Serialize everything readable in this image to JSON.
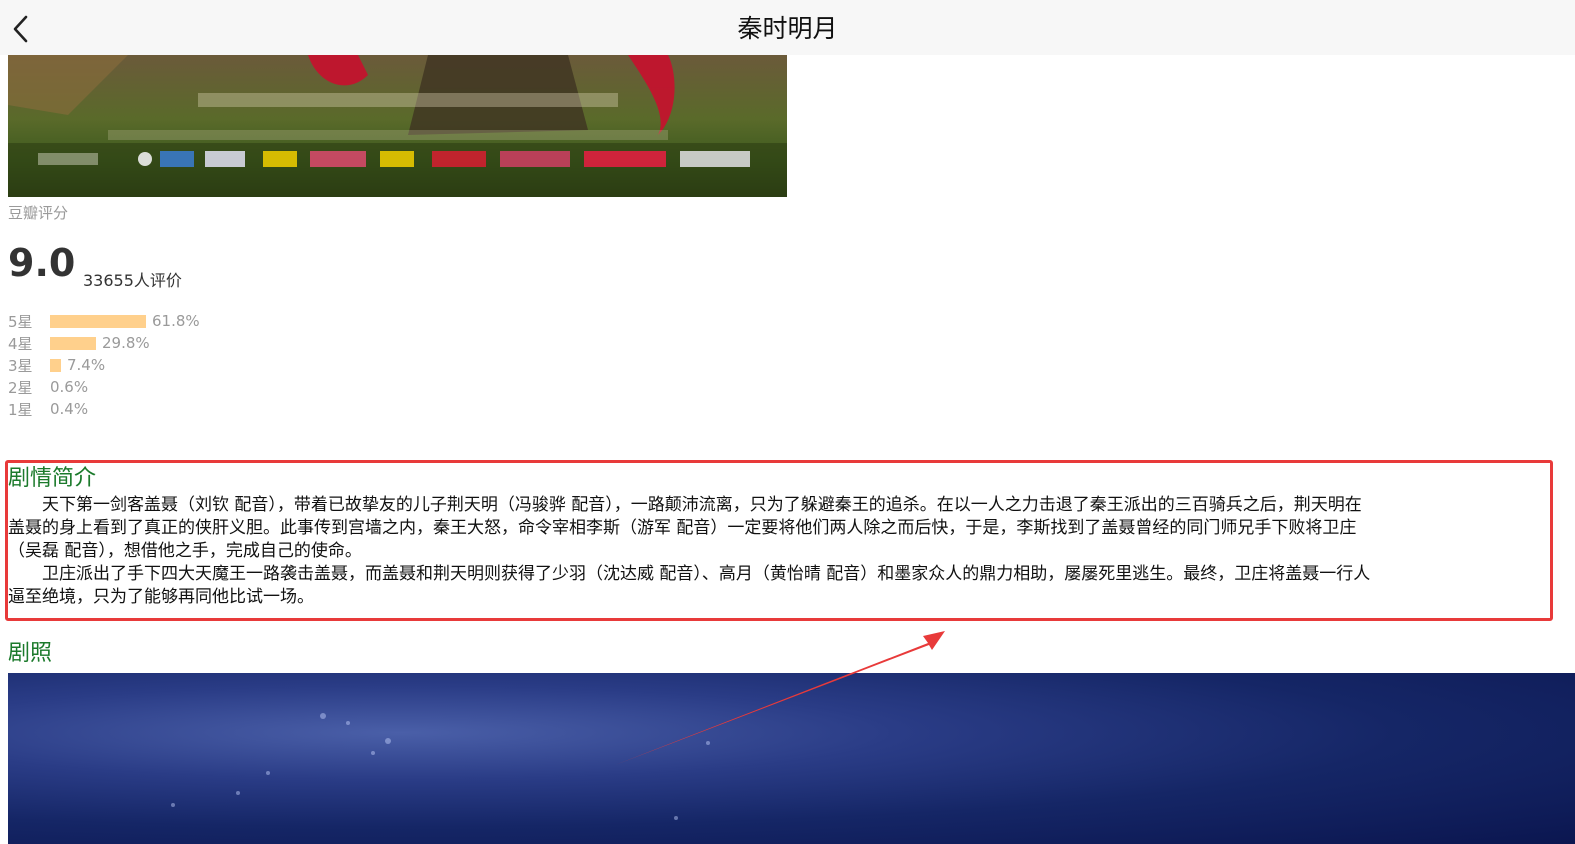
{
  "header": {
    "title": "秦时明月"
  },
  "rating": {
    "source_label": "豆瓣评分",
    "score": "9.0",
    "count_text": "33655人评价",
    "bar_color": "#ffd08c",
    "distribution": [
      {
        "label": "5星",
        "percent_text": "61.8%",
        "percent": 61.8
      },
      {
        "label": "4星",
        "percent_text": "29.8%",
        "percent": 29.8
      },
      {
        "label": "3星",
        "percent_text": "7.4%",
        "percent": 7.4
      },
      {
        "label": "2星",
        "percent_text": "0.6%",
        "percent": 0.6
      },
      {
        "label": "1星",
        "percent_text": "0.4%",
        "percent": 0.4
      }
    ]
  },
  "synopsis": {
    "title": "剧情简介",
    "lines": [
      "　　天下第一剑客盖聂（刘钦 配音），带着已故挚友的儿子荆天明（冯骏骅 配音），一路颠沛流离，只为了躲避秦王的追杀。在以一人之力击退了秦王派出的三百骑兵之后，荆天明在",
      "盖聂的身上看到了真正的侠肝义胆。此事传到宫墙之内，秦王大怒，命令宰相李斯（游军 配音）一定要将他们两人除之而后快，于是，李斯找到了盖聂曾经的同门师兄手下败将卫庄",
      "（吴磊 配音），想借他之手，完成自己的使命。",
      "　　卫庄派出了手下四大天魔王一路袭击盖聂，而盖聂和荆天明则获得了少羽（沈达威 配音）、高月（黄怡晴 配音）和墨家众人的鼎力相助，屡屡死里逃生。最终，卫庄将盖聂一行人",
      "逼至绝境，只为了能够再同他比试一场。"
    ]
  },
  "stills": {
    "title": "剧照"
  },
  "colors": {
    "section_title": "#1b7a2b",
    "highlight": "#e83a3a"
  }
}
